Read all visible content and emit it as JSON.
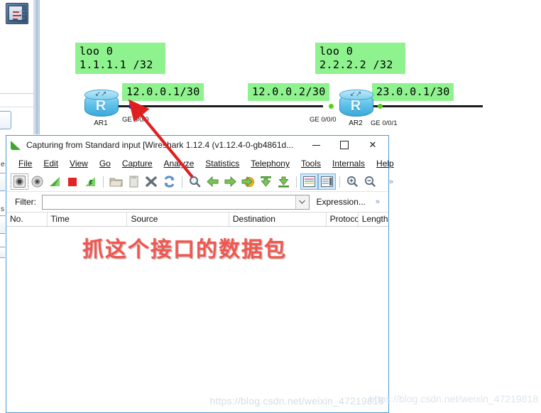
{
  "background_app": {
    "name": "eNSP topology canvas",
    "app_icon": "ensp-icon",
    "palette_fragments": [
      {
        "label": "er"
      },
      {
        "label": "s"
      }
    ]
  },
  "topology": {
    "devices": [
      {
        "id": "ar1",
        "name": "AR1",
        "glyph": "R",
        "interfaces": [
          {
            "name": "GE 0/0/0",
            "dot_color": "#0b2fe0",
            "state": "capturing"
          }
        ]
      },
      {
        "id": "ar2",
        "name": "AR2",
        "glyph": "R",
        "interfaces": [
          {
            "name": "GE 0/0/0",
            "dot_color": "#59d11c",
            "state": "up"
          },
          {
            "name": "GE 0/0/1",
            "dot_color": "#59d11c",
            "state": "up"
          }
        ]
      }
    ],
    "labels": [
      {
        "id": "ar1-loopback",
        "text": "loo 0\n1.1.1.1 /32"
      },
      {
        "id": "ar1-ge000-ip",
        "text": "12.0.0.1/30"
      },
      {
        "id": "ar2-ge000-ip",
        "text": "12.0.0.2/30"
      },
      {
        "id": "ar2-loopback",
        "text": "loo 0\n2.2.2.2 /32"
      },
      {
        "id": "ar2-ge001-ip",
        "text": "23.0.0.1/30"
      }
    ],
    "label_bg_color": "#8ef28e",
    "link_color": "#1a1a1a"
  },
  "annotation": {
    "red_note": "抓这个接口的数据包",
    "red_color": "#f0574f",
    "arrow_color": "#e02020",
    "arrow_points_to": "GE 0/0/0 of AR1"
  },
  "wireshark": {
    "title": "Capturing from Standard input    [Wireshark 1.12.4  (v1.12.4-0-gb4861d...",
    "app_icon": "wireshark-fin-icon",
    "window_buttons": {
      "minimize": "minimize-button",
      "maximize": "maximize-button",
      "close": "✕"
    },
    "menus": [
      {
        "label": "File"
      },
      {
        "label": "Edit"
      },
      {
        "label": "View"
      },
      {
        "label": "Go"
      },
      {
        "label": "Capture"
      },
      {
        "label": "Analyze"
      },
      {
        "label": "Statistics"
      },
      {
        "label": "Telephony"
      },
      {
        "label": "Tools"
      },
      {
        "label": "Internals"
      },
      {
        "label": "Help"
      }
    ],
    "toolbar": {
      "items": [
        {
          "name": "start-capture-icon",
          "selected": true
        },
        {
          "name": "capture-options-icon"
        },
        {
          "name": "restart-capture-icon"
        },
        {
          "name": "stop-capture-icon"
        },
        {
          "name": "capture-filters-icon"
        },
        {
          "name": "separator"
        },
        {
          "name": "open-file-icon"
        },
        {
          "name": "save-file-icon"
        },
        {
          "name": "close-file-icon"
        },
        {
          "name": "reload-file-icon"
        },
        {
          "name": "separator"
        },
        {
          "name": "find-packet-icon"
        },
        {
          "name": "go-back-icon"
        },
        {
          "name": "go-forward-icon"
        },
        {
          "name": "go-to-packet-icon"
        },
        {
          "name": "go-first-packet-icon"
        },
        {
          "name": "go-last-packet-icon"
        },
        {
          "name": "separator"
        },
        {
          "name": "colorize-packets-icon",
          "active": true
        },
        {
          "name": "auto-scroll-icon",
          "active": true
        },
        {
          "name": "separator"
        },
        {
          "name": "zoom-in-icon"
        },
        {
          "name": "zoom-out-icon"
        }
      ],
      "overflow": "»"
    },
    "filter": {
      "label": "Filter:",
      "value": "",
      "placeholder": "",
      "dropdown_icon": "chevron-down-icon",
      "expression_label": "Expression...",
      "overflow": "»"
    },
    "packet_list": {
      "columns": [
        {
          "label": "No.",
          "width": 60
        },
        {
          "label": "Time",
          "width": 118
        },
        {
          "label": "Source",
          "width": 150
        },
        {
          "label": "Destination",
          "width": 143
        },
        {
          "label": "Protocol",
          "width": 40
        },
        {
          "label": "Length",
          "width": 40
        }
      ],
      "rows": []
    }
  },
  "watermark": {
    "text": "https://blog.csdn.net/weixin_47219818"
  }
}
